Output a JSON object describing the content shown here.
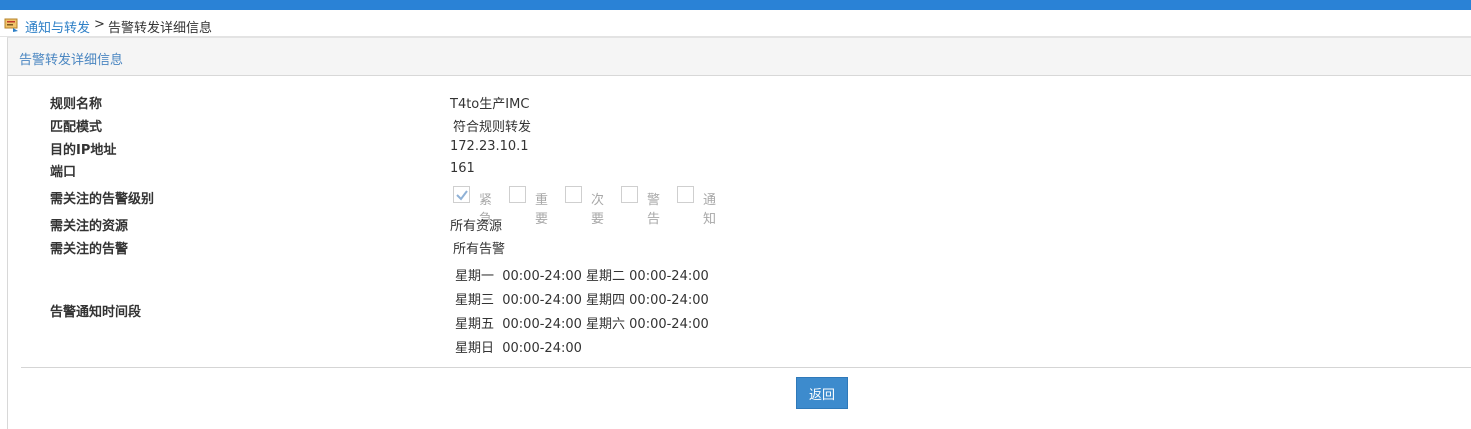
{
  "breadcrumb": {
    "link": "通知与转发",
    "separator": ">",
    "current": "告警转发详细信息"
  },
  "panel": {
    "title": "告警转发详细信息"
  },
  "fields": [
    {
      "label": "规则名称",
      "value": "T4to生产IMC"
    },
    {
      "label": "匹配模式",
      "value": "符合规则转发"
    },
    {
      "label": "目的IP地址",
      "value": "172.23.10.1"
    },
    {
      "label": "端口",
      "value": "161"
    },
    {
      "label": "需关注的告警级别",
      "value": ""
    },
    {
      "label": "需关注的资源",
      "value": "所有资源"
    },
    {
      "label": "需关注的告警",
      "value": "所有告警"
    },
    {
      "label": "告警通知时间段",
      "value": ""
    }
  ],
  "levels": [
    {
      "label": "紧急",
      "checked": true
    },
    {
      "label": "重要",
      "checked": false
    },
    {
      "label": "次要",
      "checked": false
    },
    {
      "label": "警告",
      "checked": false
    },
    {
      "label": "通知",
      "checked": false
    }
  ],
  "schedule": [
    "星期一  00:00-24:00 星期二 00:00-24:00",
    "星期三  00:00-24:00 星期四 00:00-24:00",
    "星期五  00:00-24:00 星期六 00:00-24:00",
    "星期日  00:00-24:00"
  ],
  "buttons": {
    "back": "返回"
  },
  "colors": {
    "accent": "#2a82d6",
    "link": "#2d7fc6",
    "button": "#3d8bcd"
  }
}
